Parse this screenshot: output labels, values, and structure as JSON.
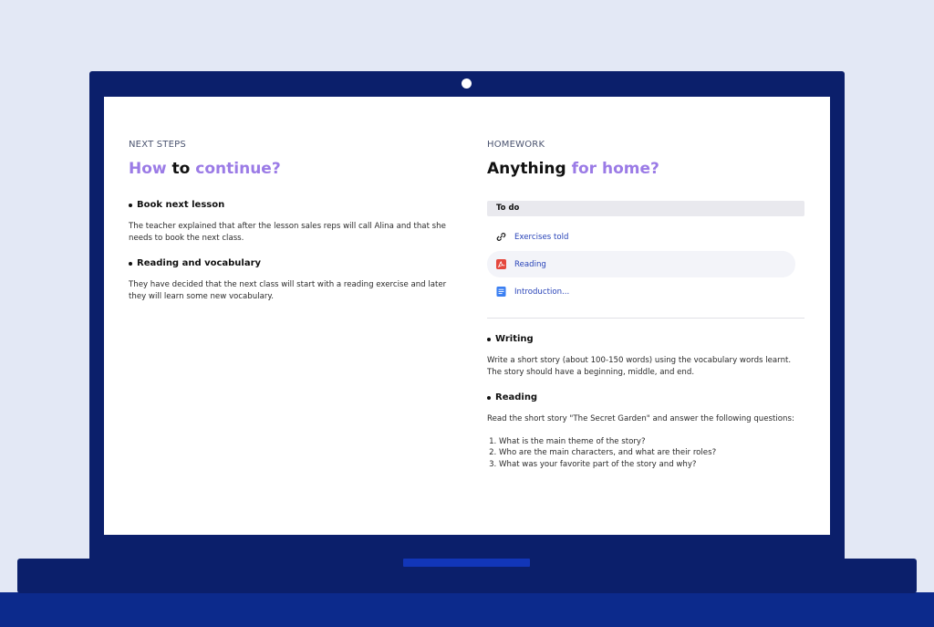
{
  "colors": {
    "background": "#e3e8f5",
    "laptop_frame": "#0b1f6b",
    "bottom_bar": "#0c2a8c",
    "trackpad": "#1236b8",
    "accent": "#9b7be6",
    "link": "#2843b8",
    "pdf_icon": "#e5483e",
    "doc_icon": "#3b7ff2"
  },
  "next_steps": {
    "eyebrow": "NEXT STEPS",
    "headline": {
      "part1": "How",
      "part2": "to",
      "part3": "continue?"
    },
    "items": [
      {
        "title": "Book next lesson",
        "text": "The teacher explained that after the lesson sales reps will call Alina and that she needs to book the next class."
      },
      {
        "title": "Reading and vocabulary",
        "text": "They have decided that the next class will start with a reading exercise and later they will learn some new vocabulary."
      }
    ]
  },
  "homework": {
    "eyebrow": "HOMEWORK",
    "headline": {
      "part1": "Anything",
      "part2": "for home?"
    },
    "todo_header": "To do",
    "todo_items": [
      {
        "label": "Exercises told",
        "icon": "link-icon"
      },
      {
        "label": "Reading",
        "icon": "pdf-icon"
      },
      {
        "label": "Introduction...",
        "icon": "document-icon"
      }
    ],
    "writing": {
      "title": "Writing",
      "text": "Write a short story (about 100-150 words) using the vocabulary words learnt. The story should have a beginning, middle, and end."
    },
    "reading": {
      "title": "Reading",
      "text": "Read the short story \"The Secret Garden\" and answer the following questions:",
      "questions": [
        "What is the main theme of the story?",
        "Who are the main characters, and what are their roles?",
        "What was your favorite part of the story and why?"
      ]
    }
  }
}
